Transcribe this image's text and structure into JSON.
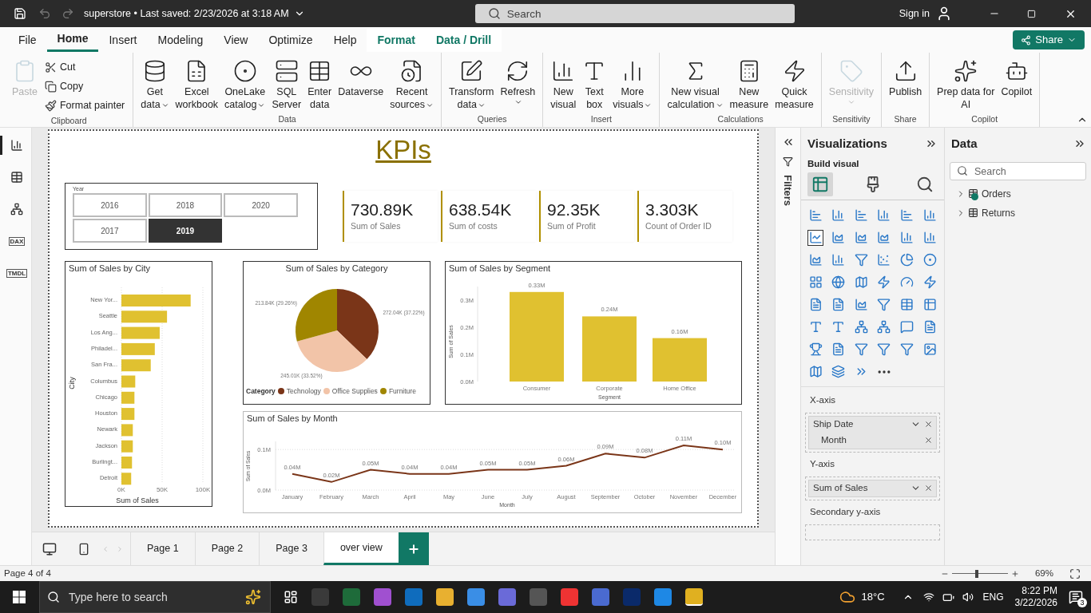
{
  "title_bar": {
    "file_title": "superstore • Last saved: 2/23/2026 at 3:18 AM",
    "search": {
      "placeholder": "Search"
    },
    "sign_in": "Sign in"
  },
  "ribbon_tabs": [
    {
      "label": "File",
      "selected": false,
      "kind": "plain"
    },
    {
      "label": "Home",
      "selected": true,
      "kind": "plain"
    },
    {
      "label": "Insert",
      "selected": false,
      "kind": "plain"
    },
    {
      "label": "Modeling",
      "selected": false,
      "kind": "plain"
    },
    {
      "label": "View",
      "selected": false,
      "kind": "plain"
    },
    {
      "label": "Optimize",
      "selected": false,
      "kind": "plain"
    },
    {
      "label": "Help",
      "selected": false,
      "kind": "plain"
    },
    {
      "label": "Format",
      "selected": false,
      "kind": "contextual"
    },
    {
      "label": "Data / Drill",
      "selected": false,
      "kind": "contextual"
    }
  ],
  "share_button": "Share",
  "ribbon_groups": [
    {
      "name": "Clipboard",
      "items": [
        {
          "kind": "large",
          "lines": [
            "Paste"
          ],
          "dropdown": false,
          "disabled": true
        },
        {
          "kind": "small",
          "lines": [
            "Cut"
          ],
          "dropdown": false,
          "disabled": false
        },
        {
          "kind": "small",
          "lines": [
            "Copy"
          ],
          "dropdown": false,
          "disabled": false
        },
        {
          "kind": "small",
          "lines": [
            "Format painter"
          ],
          "dropdown": false,
          "disabled": false
        }
      ]
    },
    {
      "name": "Data",
      "items": [
        {
          "kind": "large",
          "lines": [
            "Get",
            "data"
          ],
          "dropdown": true,
          "disabled": false
        },
        {
          "kind": "large",
          "lines": [
            "Excel",
            "workbook"
          ],
          "dropdown": false,
          "disabled": false
        },
        {
          "kind": "large",
          "lines": [
            "OneLake",
            "catalog"
          ],
          "dropdown": true,
          "disabled": false
        },
        {
          "kind": "large",
          "lines": [
            "SQL",
            "Server"
          ],
          "dropdown": false,
          "disabled": false
        },
        {
          "kind": "large",
          "lines": [
            "Enter",
            "data"
          ],
          "dropdown": false,
          "disabled": false
        },
        {
          "kind": "large",
          "lines": [
            "Dataverse"
          ],
          "dropdown": false,
          "disabled": false
        },
        {
          "kind": "large",
          "lines": [
            "Recent",
            "sources"
          ],
          "dropdown": true,
          "disabled": false
        }
      ]
    },
    {
      "name": "Queries",
      "items": [
        {
          "kind": "large",
          "lines": [
            "Transform",
            "data"
          ],
          "dropdown": true,
          "disabled": false
        },
        {
          "kind": "large",
          "lines": [
            "Refresh"
          ],
          "dropdown": true,
          "disabled": false
        }
      ]
    },
    {
      "name": "Insert",
      "items": [
        {
          "kind": "large",
          "lines": [
            "New",
            "visual"
          ],
          "dropdown": false,
          "disabled": false
        },
        {
          "kind": "large",
          "lines": [
            "Text",
            "box"
          ],
          "dropdown": false,
          "disabled": false
        },
        {
          "kind": "large",
          "lines": [
            "More",
            "visuals"
          ],
          "dropdown": true,
          "disabled": false
        }
      ]
    },
    {
      "name": "Calculations",
      "items": [
        {
          "kind": "large",
          "lines": [
            "New visual",
            "calculation"
          ],
          "dropdown": true,
          "disabled": false
        },
        {
          "kind": "large",
          "lines": [
            "New",
            "measure"
          ],
          "dropdown": false,
          "disabled": false
        },
        {
          "kind": "large",
          "lines": [
            "Quick",
            "measure"
          ],
          "dropdown": false,
          "disabled": false
        }
      ]
    },
    {
      "name": "Sensitivity",
      "items": [
        {
          "kind": "large",
          "lines": [
            "Sensitivity"
          ],
          "dropdown": true,
          "disabled": true
        }
      ]
    },
    {
      "name": "Share",
      "items": [
        {
          "kind": "large",
          "lines": [
            "Publish"
          ],
          "dropdown": false,
          "disabled": false
        }
      ]
    },
    {
      "name": "Copilot",
      "items": [
        {
          "kind": "large",
          "lines": [
            "Prep data for",
            "AI"
          ],
          "dropdown": false,
          "disabled": false
        },
        {
          "kind": "large",
          "lines": [
            "Copilot"
          ],
          "dropdown": false,
          "disabled": false
        }
      ]
    }
  ],
  "views": [
    {
      "kind": "report",
      "selected": true
    },
    {
      "kind": "table",
      "selected": false
    },
    {
      "kind": "model",
      "selected": false
    },
    {
      "kind": "dax",
      "label": "DAX",
      "selected": false
    },
    {
      "kind": "tmdl",
      "label": "TMDL",
      "selected": false
    }
  ],
  "report_title": "KPIs",
  "slicer": {
    "title": "Year",
    "options": [
      {
        "label": "2016",
        "selected": false
      },
      {
        "label": "2018",
        "selected": false
      },
      {
        "label": "2020",
        "selected": false
      },
      {
        "label": "2017",
        "selected": false
      },
      {
        "label": "2019",
        "selected": true
      }
    ]
  },
  "kpi_cards": [
    {
      "value": "730.89K",
      "label": "Sum of Sales"
    },
    {
      "value": "638.54K",
      "label": "Sum of costs"
    },
    {
      "value": "92.35K",
      "label": "Sum of Profit"
    },
    {
      "value": "3.303K",
      "label": "Count of Order ID"
    }
  ],
  "city_chart": {
    "chart_data": {
      "type": "bar",
      "orientation": "horizontal",
      "title": "Sum of Sales by City",
      "xlabel": "Sum of Sales",
      "ylabel": "City",
      "categories": [
        "New Yor...",
        "Seattle",
        "Los Ang...",
        "Philadel...",
        "San Fra...",
        "Columbus",
        "Chicago",
        "Houston",
        "Newark",
        "Jackson",
        "Burlingt...",
        "Detroit"
      ],
      "series": [
        {
          "color": "#e0c130",
          "values": [
            85000,
            56000,
            47000,
            41000,
            36000,
            17000,
            16000,
            16000,
            14000,
            14000,
            13000,
            12000
          ]
        }
      ],
      "xlim": [
        0,
        100000
      ],
      "xticks": [
        {
          "value": 0,
          "label": "0K"
        },
        {
          "value": 50000,
          "label": "50K"
        },
        {
          "value": 100000,
          "label": "100K"
        }
      ]
    }
  },
  "category_chart": {
    "chart_data": {
      "type": "pie",
      "title": "Sum of Sales by Category",
      "categories": [
        "Technology",
        "Office Supplies",
        "Furniture"
      ],
      "values": [
        37.22,
        33.52,
        29.26
      ],
      "colors": [
        "#7a3518",
        "#f2c4a8",
        "#a08600"
      ],
      "value_labels": [
        "272.04K (37.22%)",
        "245.01K (33.52%)",
        "213.84K (29.26%)"
      ],
      "legend": {
        "title": "Category"
      }
    }
  },
  "segment_chart": {
    "chart_data": {
      "type": "bar",
      "title": "Sum of Sales by Segment",
      "xlabel": "Segment",
      "ylabel": "Sum of Sales",
      "categories": [
        "Consumer",
        "Corporate",
        "Home Office"
      ],
      "series": [
        {
          "color": "#e0c130",
          "values": [
            0.33,
            0.24,
            0.16
          ]
        }
      ],
      "ylim": [
        0,
        0.35
      ],
      "yticks": [
        {
          "value": 0,
          "label": "0.0M"
        },
        {
          "value": 0.1,
          "label": "0.1M"
        },
        {
          "value": 0.2,
          "label": "0.2M"
        },
        {
          "value": 0.3,
          "label": "0.3M"
        }
      ],
      "value_labels": [
        "0.33M",
        "0.24M",
        "0.16M"
      ]
    }
  },
  "month_chart": {
    "chart_data": {
      "type": "line",
      "title": "Sum of Sales by Month",
      "xlabel": "Month",
      "ylabel": "Sum of Sales",
      "categories": [
        "January",
        "February",
        "March",
        "April",
        "May",
        "June",
        "July",
        "August",
        "September",
        "October",
        "November",
        "December"
      ],
      "series": [
        {
          "color": "#7a3518",
          "values": [
            0.04,
            0.02,
            0.05,
            0.04,
            0.04,
            0.05,
            0.05,
            0.06,
            0.09,
            0.08,
            0.11,
            0.1
          ]
        }
      ],
      "ylim": [
        0,
        0.12
      ],
      "yticks": [
        {
          "value": 0,
          "label": "0.0M"
        },
        {
          "value": 0.1,
          "label": "0.1M"
        }
      ],
      "value_labels": [
        "0.04M",
        "0.02M",
        "0.05M",
        "0.04M",
        "0.04M",
        "0.05M",
        "0.05M",
        "0.06M",
        "0.09M",
        "0.08M",
        "0.11M",
        "0.10M"
      ]
    }
  },
  "page_tabs": [
    {
      "label": "Page 1",
      "selected": false
    },
    {
      "label": "Page 2",
      "selected": false
    },
    {
      "label": "Page 3",
      "selected": false
    },
    {
      "label": "over view",
      "selected": true
    }
  ],
  "filters_pane": {
    "label": "Filters"
  },
  "visualizations": {
    "title": "Visualizations",
    "subtitle": "Build visual",
    "modes": [
      {
        "selected": true
      },
      {
        "selected": false
      },
      {
        "selected": false
      }
    ],
    "visual_types": [
      {
        "selected": false
      },
      {
        "selected": false
      },
      {
        "selected": false
      },
      {
        "selected": false
      },
      {
        "selected": false
      },
      {
        "selected": false
      },
      {
        "selected": true
      },
      {
        "selected": false
      },
      {
        "selected": false
      },
      {
        "selected": false
      },
      {
        "selected": false
      },
      {
        "selected": false
      },
      {
        "selected": false
      },
      {
        "selected": false
      },
      {
        "selected": false
      },
      {
        "selected": false
      },
      {
        "selected": false
      },
      {
        "selected": false
      },
      {
        "selected": false
      },
      {
        "selected": false
      },
      {
        "selected": false
      },
      {
        "selected": false
      },
      {
        "selected": false
      },
      {
        "selected": false
      },
      {
        "selected": false
      },
      {
        "selected": false
      },
      {
        "selected": false
      },
      {
        "selected": false
      },
      {
        "selected": false
      },
      {
        "selected": false
      },
      {
        "selected": false
      },
      {
        "selected": false
      },
      {
        "selected": false
      },
      {
        "selected": false
      },
      {
        "selected": false
      },
      {
        "selected": false
      },
      {
        "selected": false
      },
      {
        "selected": false
      },
      {
        "selected": false
      },
      {
        "selected": false
      },
      {
        "selected": false
      },
      {
        "selected": false
      },
      {
        "selected": false
      },
      {
        "selected": false
      },
      {
        "selected": false
      }
    ],
    "wells": [
      {
        "label": "X-axis",
        "fields": [
          {
            "name": "Ship Date",
            "kind": "field"
          },
          {
            "name": "Month",
            "kind": "sub"
          }
        ]
      },
      {
        "label": "Y-axis",
        "fields": [
          {
            "name": "Sum of Sales",
            "kind": "field"
          }
        ]
      },
      {
        "label": "Secondary y-axis"
      }
    ]
  },
  "data_pane": {
    "title": "Data",
    "search": {
      "placeholder": "Search"
    },
    "tables": [
      {
        "name": "Orders",
        "checked": true
      },
      {
        "name": "Returns",
        "checked": false
      }
    ]
  },
  "status_bar": {
    "page": "Page 4 of 4",
    "zoom": {
      "level": 0.45,
      "reading": "69%"
    }
  },
  "taskbar": {
    "search": {
      "placeholder": "Type here to search"
    },
    "temperature": "18°C",
    "language": "ENG",
    "time": "8:22 PM",
    "date": "3/22/2026",
    "notification_count": "3"
  }
}
